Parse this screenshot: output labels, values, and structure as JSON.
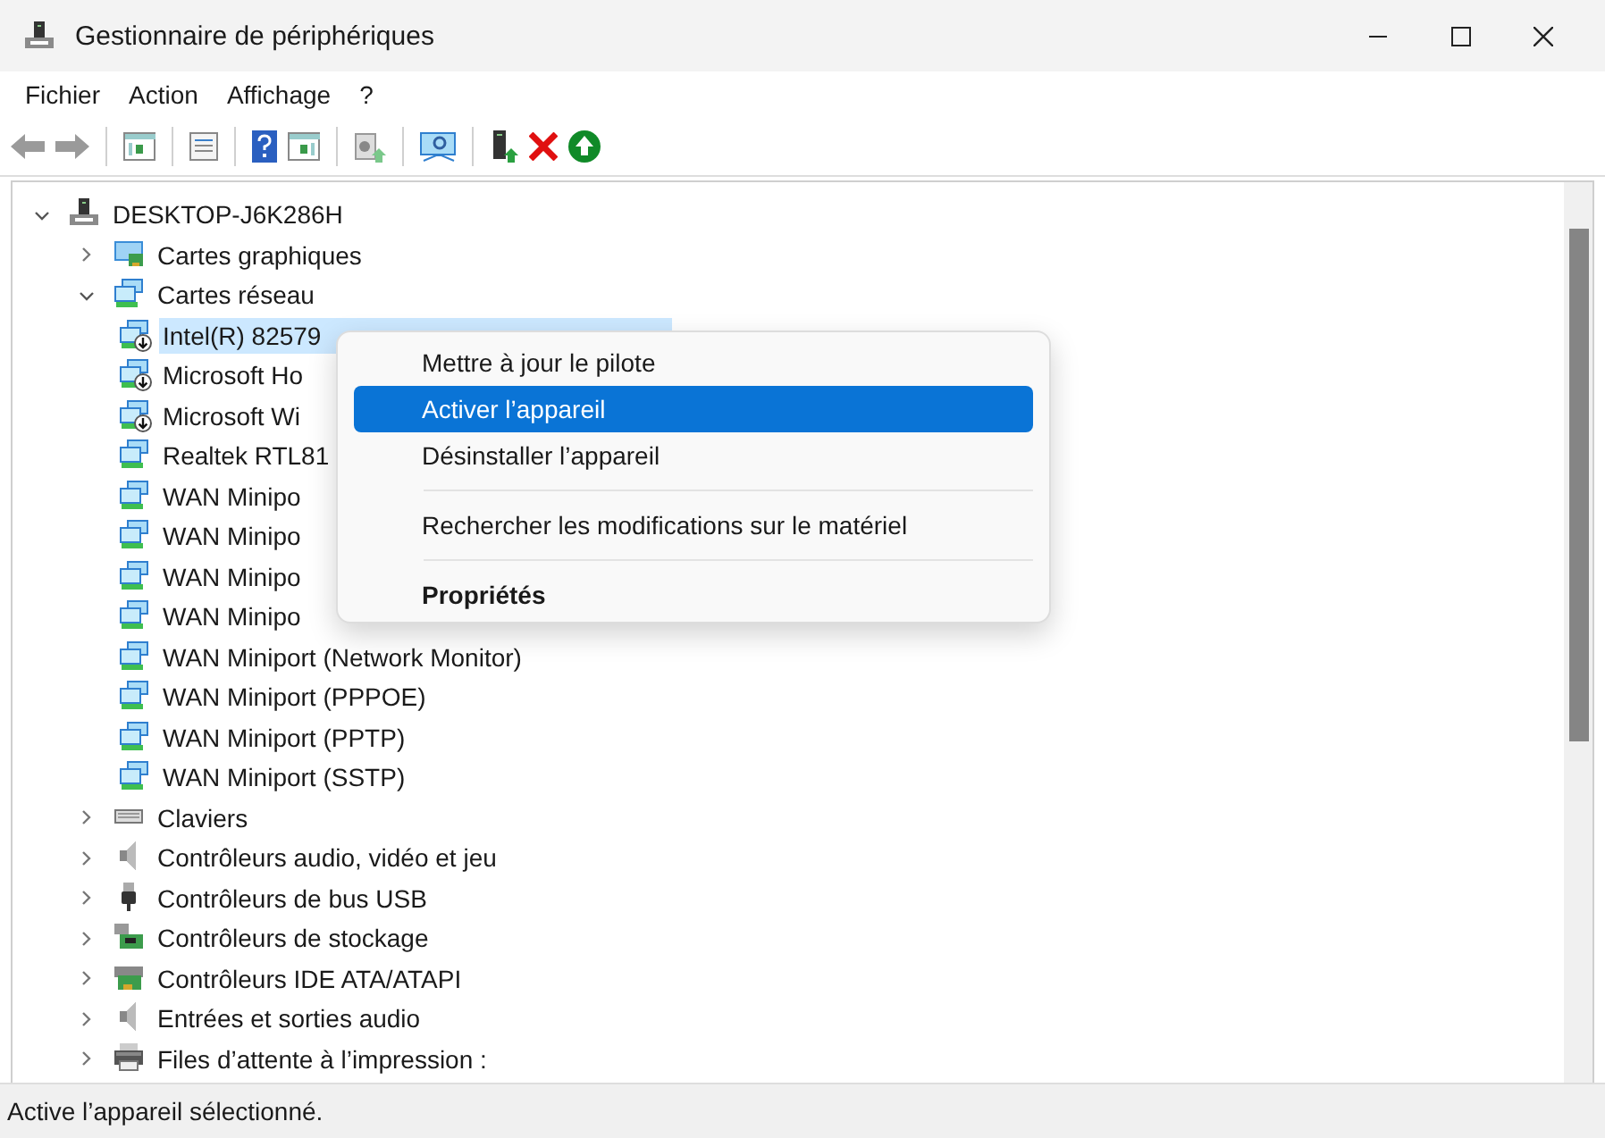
{
  "window": {
    "title": "Gestionnaire de périphériques"
  },
  "menu_bar": [
    {
      "label": "Fichier"
    },
    {
      "label": "Action"
    },
    {
      "label": "Affichage"
    },
    {
      "label": "?"
    }
  ],
  "toolbar": [
    {
      "kind": "back",
      "disabled": true
    },
    {
      "kind": "forward",
      "disabled": true
    },
    {
      "kind": "sep"
    },
    {
      "kind": "console-tree"
    },
    {
      "kind": "sep"
    },
    {
      "kind": "properties"
    },
    {
      "kind": "sep"
    },
    {
      "kind": "help"
    },
    {
      "kind": "action-pane"
    },
    {
      "kind": "sep"
    },
    {
      "kind": "update-driver",
      "disabled": true
    },
    {
      "kind": "sep"
    },
    {
      "kind": "scan"
    },
    {
      "kind": "sep"
    },
    {
      "kind": "enable"
    },
    {
      "kind": "uninstall"
    },
    {
      "kind": "download"
    }
  ],
  "tree": [
    {
      "label": "DESKTOP-J6K286H",
      "kind": "computer",
      "expanded": true,
      "children": [
        {
          "label": "Cartes graphiques",
          "kind": "display",
          "expanded": false
        },
        {
          "label": "Cartes réseau",
          "kind": "network",
          "expanded": true,
          "children": [
            {
              "label": "Intel(R) 82579",
              "kind": "network",
              "disabled": true,
              "selected": true
            },
            {
              "label": "Microsoft Ho",
              "kind": "network",
              "disabled": true,
              "selected": false
            },
            {
              "label": "Microsoft Wi",
              "kind": "network",
              "disabled": true,
              "selected": false
            },
            {
              "label": "Realtek RTL81",
              "kind": "network",
              "disabled": false,
              "selected": false
            },
            {
              "label": "WAN Minipo",
              "kind": "network",
              "disabled": false,
              "selected": false
            },
            {
              "label": "WAN Minipo",
              "kind": "network",
              "disabled": false,
              "selected": false
            },
            {
              "label": "WAN Minipo",
              "kind": "network",
              "disabled": false,
              "selected": false
            },
            {
              "label": "WAN Minipo",
              "kind": "network",
              "disabled": false,
              "selected": false
            },
            {
              "label": "WAN Miniport (Network Monitor)",
              "kind": "network",
              "disabled": false,
              "selected": false
            },
            {
              "label": "WAN Miniport (PPPOE)",
              "kind": "network",
              "disabled": false,
              "selected": false
            },
            {
              "label": "WAN Miniport (PPTP)",
              "kind": "network",
              "disabled": false,
              "selected": false
            },
            {
              "label": "WAN Miniport (SSTP)",
              "kind": "network",
              "disabled": false,
              "selected": false
            }
          ]
        },
        {
          "label": "Claviers",
          "kind": "keyboard",
          "expanded": false
        },
        {
          "label": "Contrôleurs audio, vidéo et jeu",
          "kind": "audio",
          "expanded": false
        },
        {
          "label": "Contrôleurs de bus USB",
          "kind": "usb",
          "expanded": false
        },
        {
          "label": "Contrôleurs de stockage",
          "kind": "storage",
          "expanded": false
        },
        {
          "label": "Contrôleurs IDE ATA/ATAPI",
          "kind": "ide",
          "expanded": false
        },
        {
          "label": "Entrées et sorties audio",
          "kind": "audio",
          "expanded": false
        },
        {
          "label": "Files d’attente à l’impression :",
          "kind": "printer",
          "expanded": false
        }
      ]
    }
  ],
  "context_menu": [
    {
      "kind": "item",
      "label": "Mettre à jour le pilote",
      "selected": false,
      "default": false
    },
    {
      "kind": "item",
      "label": "Activer l’appareil",
      "selected": true,
      "default": false
    },
    {
      "kind": "item",
      "label": "Désinstaller l’appareil",
      "selected": false,
      "default": false
    },
    {
      "kind": "separator"
    },
    {
      "kind": "item",
      "label": "Rechercher les modifications sur le matériel",
      "selected": false,
      "default": false
    },
    {
      "kind": "separator"
    },
    {
      "kind": "item",
      "label": "Propriétés",
      "selected": false,
      "default": true
    }
  ],
  "status_bar": {
    "text": "Active l’appareil sélectionné."
  }
}
